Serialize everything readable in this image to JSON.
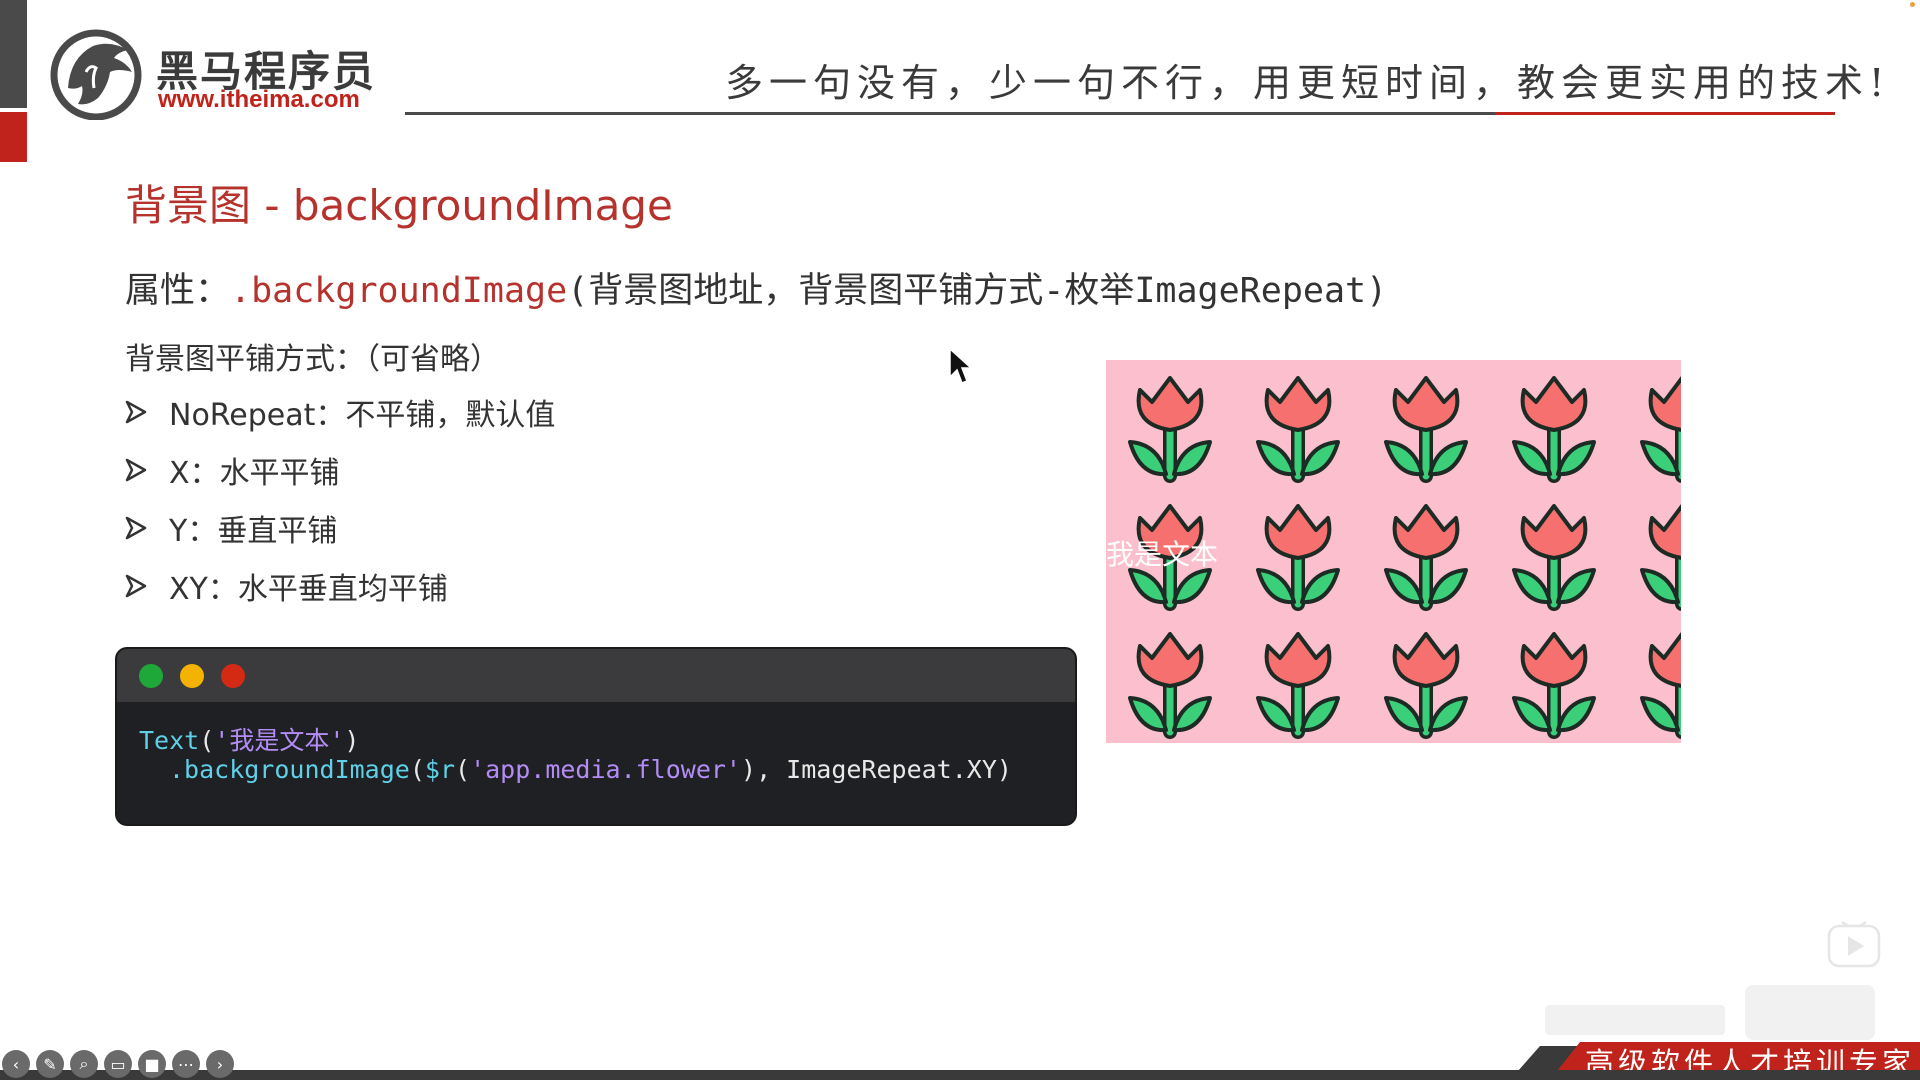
{
  "brand": {
    "name_cn": "黑马程序员",
    "url": "www.itheima.com",
    "colors": {
      "red": "#c0231b",
      "dark": "#4a4a4a"
    }
  },
  "header": {
    "slogan": "多一句没有，少一句不行，用更短时间，教会更实用的技术!"
  },
  "slide": {
    "title": "背景图 - backgroundImage",
    "property": {
      "prefix": "属性：",
      "method": ".backgroundImage",
      "args": "(背景图地址，背景图平铺方式-枚举ImageRepeat)"
    },
    "repeat_title": "背景图平铺方式：（可省略）",
    "options": [
      {
        "label": "NoRepeat：不平铺，默认值"
      },
      {
        "label": "X：水平平铺"
      },
      {
        "label": "Y：垂直平铺"
      },
      {
        "label": "XY：水平垂直均平铺"
      }
    ]
  },
  "code": {
    "window_dots": [
      "#1fa83a",
      "#f3b300",
      "#d42a14"
    ],
    "line1": {
      "fn": "Text",
      "open": "(",
      "str": "'我是文本'",
      "close": ")"
    },
    "line2": {
      "method": ".backgroundImage",
      "open": "(",
      "fn": "$r",
      "inner_open": "(",
      "str": "'app.media.flower'",
      "inner_close": ")",
      "comma": ", ",
      "enum": "ImageRepeat.XY",
      "close": ")"
    }
  },
  "demo": {
    "text": "我是文本",
    "background": "#fbbfcd",
    "tile_icon": "tulip-icon"
  },
  "footer": {
    "tagline": "高级软件人才培训专家"
  },
  "player_controls": [
    "back-icon",
    "pen-icon",
    "zoom-icon",
    "cc-icon",
    "camera-icon",
    "more-icon",
    "forward-icon"
  ]
}
